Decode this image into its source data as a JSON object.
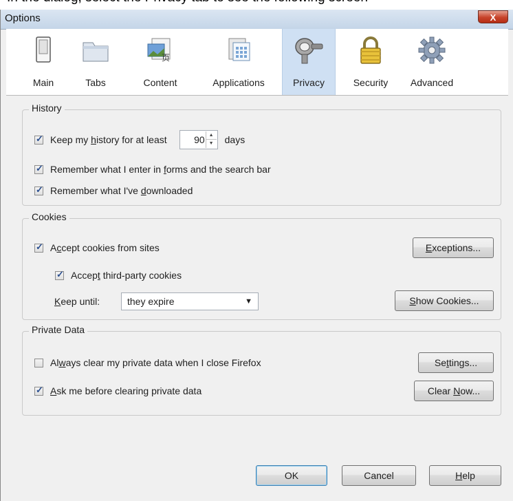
{
  "caption": "In the dialog, select the Privacy tab to see the following screen",
  "window": {
    "title": "Options",
    "close_glyph": "X"
  },
  "toolbar": {
    "items": [
      {
        "label": "Main",
        "icon": "switch-icon"
      },
      {
        "label": "Tabs",
        "icon": "tabs-icon"
      },
      {
        "label": "Content",
        "icon": "content-icon"
      },
      {
        "label": "Applications",
        "icon": "applications-icon"
      },
      {
        "label": "Privacy",
        "icon": "privacy-mask-icon",
        "selected": true
      },
      {
        "label": "Security",
        "icon": "lock-icon"
      },
      {
        "label": "Advanced",
        "icon": "gear-icon"
      }
    ]
  },
  "history": {
    "legend": "History",
    "keep_history": {
      "checked": true,
      "label_pre": "Keep my ",
      "label_u": "h",
      "label_post": "istory for at least",
      "days_value": "90",
      "days_unit": "days"
    },
    "forms": {
      "checked": true,
      "label_pre": "Remember what I enter in ",
      "label_u": "f",
      "label_post": "orms and the search bar"
    },
    "downloads": {
      "checked": true,
      "label_pre": "Remember what I've ",
      "label_u": "d",
      "label_post": "ownloaded"
    }
  },
  "cookies": {
    "legend": "Cookies",
    "accept": {
      "checked": true,
      "label_pre": "A",
      "label_u": "c",
      "label_post": "cept cookies from sites"
    },
    "third_party": {
      "checked": true,
      "label_pre": "Accep",
      "label_u": "t",
      "label_post": " third-party cookies"
    },
    "keep_until": {
      "label_pre": "",
      "label_u": "K",
      "label_post": "eep until:",
      "value": "they expire"
    },
    "exceptions_btn": {
      "label_pre": "",
      "label_u": "E",
      "label_post": "xceptions..."
    },
    "show_cookies_btn": {
      "label_pre": "",
      "label_u": "S",
      "label_post": "how Cookies..."
    }
  },
  "private_data": {
    "legend": "Private Data",
    "always_clear": {
      "checked": false,
      "label_pre": "Al",
      "label_u": "w",
      "label_post": "ays clear my private data when I close Firefox"
    },
    "ask_before": {
      "checked": true,
      "label_pre": "",
      "label_u": "A",
      "label_post": "sk me before clearing private data"
    },
    "settings_btn": {
      "label_pre": "Se",
      "label_u": "t",
      "label_post": "tings..."
    },
    "clear_now_btn": {
      "label_pre": "Clear ",
      "label_u": "N",
      "label_post": "ow..."
    }
  },
  "footer": {
    "ok": "OK",
    "cancel": "Cancel",
    "help_pre": "",
    "help_u": "H",
    "help_post": "elp"
  }
}
